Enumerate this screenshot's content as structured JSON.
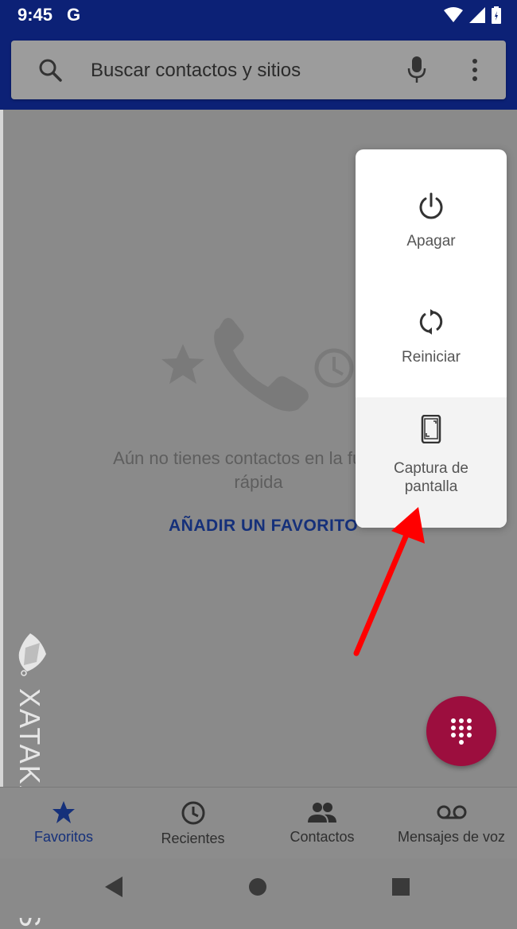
{
  "status_bar": {
    "time": "9:45",
    "notification_letter": "G"
  },
  "search": {
    "placeholder": "Buscar contactos y sitios"
  },
  "empty_state": {
    "message_line1": "Aún no tienes contactos en la función",
    "message_line2": "rápida",
    "action": "AÑADIR UN FAVORITO"
  },
  "power_menu": {
    "items": [
      {
        "label": "Apagar",
        "icon": "power-icon"
      },
      {
        "label": "Reiniciar",
        "icon": "restart-icon"
      },
      {
        "label_line1": "Captura de",
        "label_line2": "pantalla",
        "icon": "screenshot-icon"
      }
    ]
  },
  "bottom_nav": {
    "tabs": [
      {
        "label": "Favoritos",
        "icon": "star-icon",
        "selected": true
      },
      {
        "label": "Recientes",
        "icon": "clock-icon"
      },
      {
        "label": "Contactos",
        "icon": "people-icon"
      },
      {
        "label": "Mensajes de voz",
        "icon": "voicemail-icon"
      }
    ]
  },
  "watermark": {
    "text": "XATAKA BASICS"
  },
  "colors": {
    "header_blue": "#0c2176",
    "accent_blue": "#15307a",
    "fab": "#9c0e3e",
    "annotation_arrow": "#ff0000"
  }
}
